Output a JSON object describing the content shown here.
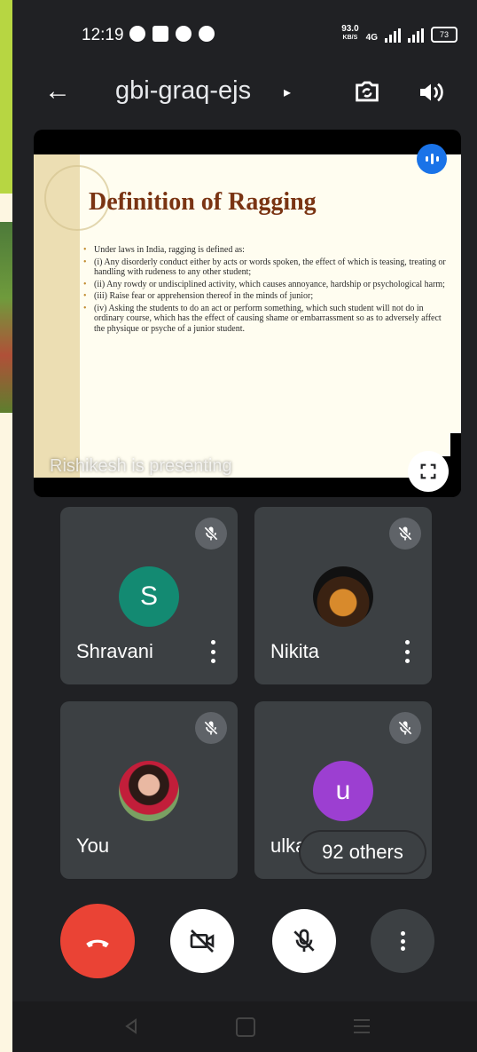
{
  "status_bar": {
    "time": "12:19",
    "speed_value": "93.0",
    "speed_unit": "KB/S",
    "network": "4G",
    "battery": "73"
  },
  "header": {
    "meeting_code": "gbi-graq-ejs",
    "caret": "▸"
  },
  "presentation": {
    "slide_title": "Definition of Ragging",
    "slide_points": [
      "Under laws in India, ragging is defined as:",
      "(i) Any disorderly conduct either by acts or words spoken, the effect of which is teasing, treating or handling with rudeness to any other student;",
      "(ii) Any rowdy or undisciplined activity, which causes annoyance, hardship or psychological harm;",
      "(iii) Raise fear or apprehension thereof in the minds of junior;",
      "(iv) Asking the students to do an act or perform something, which such student will not do in ordinary course, which has the effect of causing shame or embarrassment so as to adversely affect the physique or psyche of a junior student."
    ],
    "presenter_text": "Rishikesh is presenting"
  },
  "participants": [
    {
      "name": "Shravani",
      "initial": "S",
      "avatar_color": "#138a72"
    },
    {
      "name": "Nikita",
      "initial": "",
      "avatar_color": ""
    },
    {
      "name": "You",
      "initial": "",
      "avatar_color": ""
    },
    {
      "name": "ulka",
      "initial": "u",
      "avatar_color": "#9c3fd1"
    }
  ],
  "others_badge": "92 others",
  "controls": {
    "end_call_color": "#ea4335",
    "icons": [
      "end-call-icon",
      "camera-off-icon",
      "mic-off-icon",
      "more-options-icon"
    ]
  },
  "colors": {
    "background": "#202124",
    "tile": "#3c4043",
    "accent": "#1a73e8"
  }
}
